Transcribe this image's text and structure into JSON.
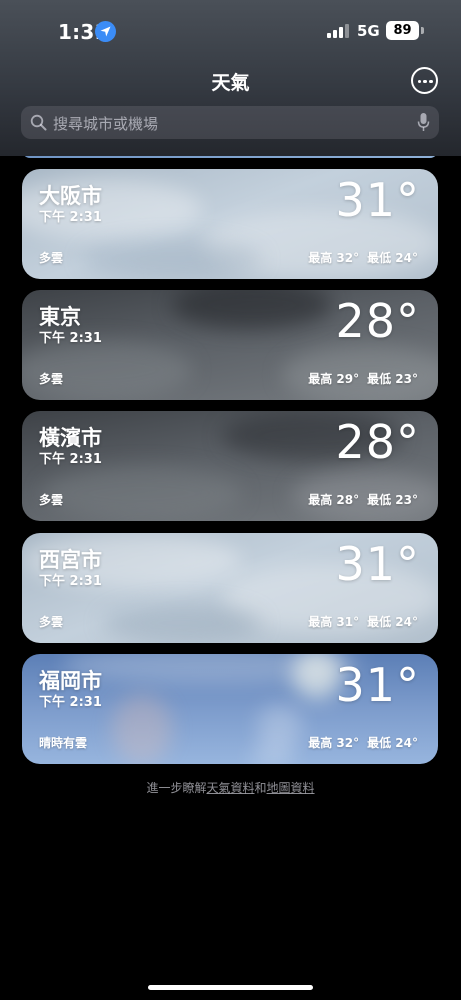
{
  "status_bar": {
    "time": "1:31",
    "network": "5G",
    "battery": "89"
  },
  "header": {
    "title": "天氣",
    "more_icon": "ellipsis-circle-icon"
  },
  "search": {
    "placeholder": "搜尋城市或機場",
    "icon": "search-icon",
    "mic_icon": "microphone-icon"
  },
  "cities": [
    {
      "name": "大阪市",
      "time": "下午 2:31",
      "temp": "31°",
      "condition": "多雲",
      "high": "最高 32°",
      "low": "最低 24°",
      "theme": "light"
    },
    {
      "name": "東京",
      "time": "下午 2:31",
      "temp": "28°",
      "condition": "多雲",
      "high": "最高 29°",
      "low": "最低 23°",
      "theme": "dark"
    },
    {
      "name": "橫濱市",
      "time": "下午 2:31",
      "temp": "28°",
      "condition": "多雲",
      "high": "最高 28°",
      "low": "最低 23°",
      "theme": "dark"
    },
    {
      "name": "西宮市",
      "time": "下午 2:31",
      "temp": "31°",
      "condition": "多雲",
      "high": "最高 31°",
      "low": "最低 24°",
      "theme": "light"
    },
    {
      "name": "福岡市",
      "time": "下午 2:31",
      "temp": "31°",
      "condition": "晴時有雲",
      "high": "最高 32°",
      "low": "最低 24°",
      "theme": "blue"
    }
  ],
  "footer": {
    "prefix": "進一步瞭解",
    "link1": "天氣資料",
    "mid": "和",
    "link2": "地圖資料"
  },
  "colors": {
    "accent": "#3b8cf6",
    "background": "#000000"
  }
}
